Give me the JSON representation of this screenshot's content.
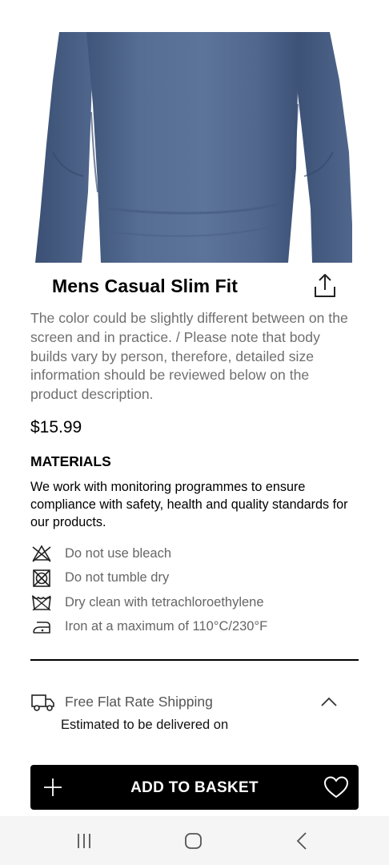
{
  "product": {
    "title": "Mens Casual Slim Fit",
    "description": "The color could be slightly different between on the screen and in practice. / Please note that body builds vary by person, therefore, detailed size information should be reviewed below on the product description.",
    "price": "$15.99",
    "image_icon": "product-photo-shirt"
  },
  "materials": {
    "heading": "MATERIALS",
    "text": "We work with monitoring programmes to ensure compliance with safety, health and quality standards for our products.",
    "care": [
      {
        "icon": "no-bleach-icon",
        "label": "Do not use bleach"
      },
      {
        "icon": "no-tumble-dry-icon",
        "label": "Do not tumble dry"
      },
      {
        "icon": "dry-clean-icon",
        "label": "Dry clean with tetrachloroethylene"
      },
      {
        "icon": "iron-icon",
        "label": "Iron at a maximum of 110°C/230°F"
      }
    ]
  },
  "shipping": {
    "label": "Free Flat Rate Shipping",
    "eta": "Estimated to be delivered on",
    "expanded": true
  },
  "actions": {
    "add_to_basket": "ADD TO BASKET"
  },
  "colors": {
    "button_bg": "#000000",
    "description_text": "#6f6f6f",
    "shirt": "#52698f"
  }
}
